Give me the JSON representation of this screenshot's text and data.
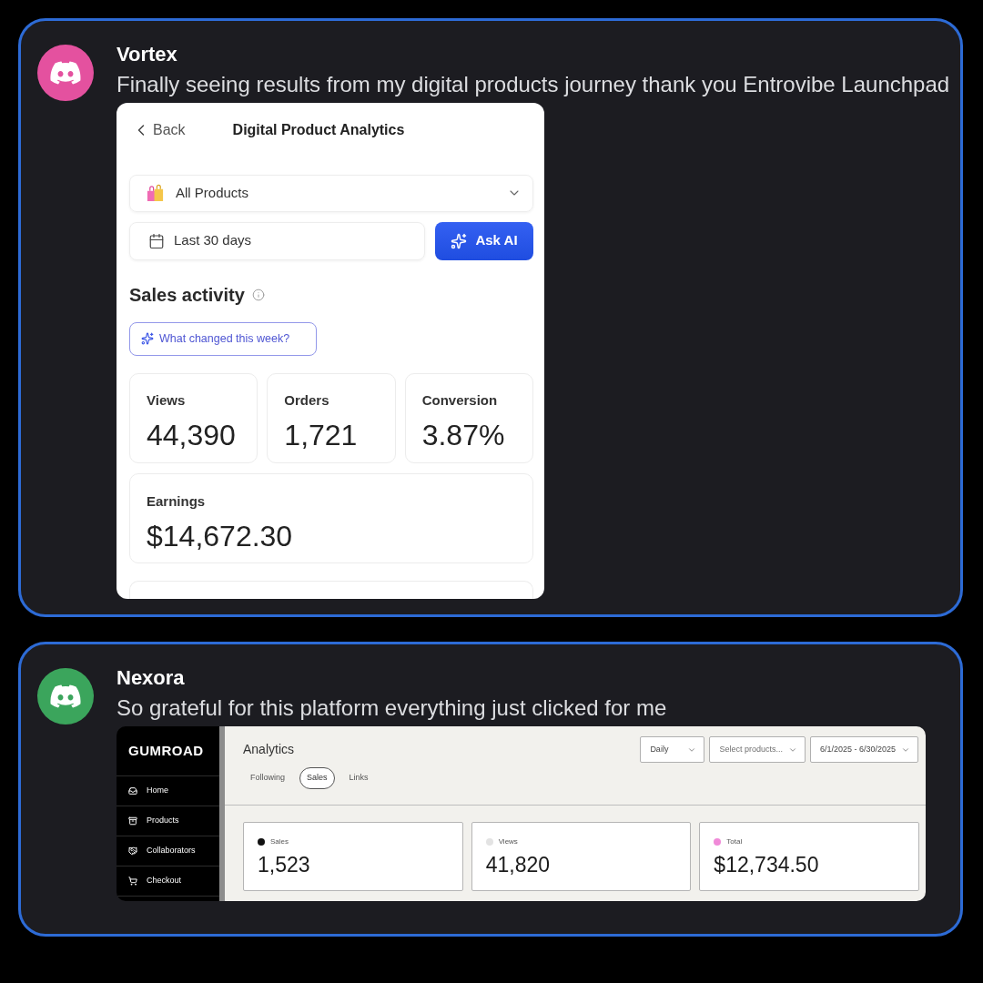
{
  "posts": [
    {
      "author": "Vortex",
      "message": "Finally seeing results from my digital products journey thank you Entrovibe Launchpad",
      "color": "#e4519f",
      "attachment": {
        "kind": "mobile",
        "back": "Back",
        "title": "Digital Product Analytics",
        "product_select": {
          "value": "All Products"
        },
        "date_select": {
          "value": "Last 30 days"
        },
        "ask_button": "Ask AI",
        "section_title": "Sales activity",
        "suggestion": "What changed this week?",
        "stats": [
          {
            "label": "Views",
            "value": "44,390"
          },
          {
            "label": "Orders",
            "value": "1,721"
          },
          {
            "label": "Conversion",
            "value": "3.87%"
          }
        ],
        "earnings": {
          "label": "Earnings",
          "value": "$14,672.30"
        }
      }
    },
    {
      "author": "Nexora",
      "message": "So grateful for this platform everything just clicked for me",
      "color": "#3ba55c",
      "attachment": {
        "kind": "dashboard",
        "logo": "GUMROAD",
        "nav": [
          {
            "label": "Home"
          },
          {
            "label": "Products"
          },
          {
            "label": "Collaborators"
          },
          {
            "label": "Checkout"
          }
        ],
        "title": "Analytics",
        "tabs": [
          {
            "label": "Following",
            "selected": false
          },
          {
            "label": "Sales",
            "selected": true
          },
          {
            "label": "Links",
            "selected": false
          }
        ],
        "filters": [
          {
            "value": "Daily"
          },
          {
            "placeholder": "Select products..."
          },
          {
            "value": "6/1/2025 - 6/30/2025"
          }
        ],
        "stats": [
          {
            "label": "Sales",
            "value": "1,523",
            "color": "#111111"
          },
          {
            "label": "Views",
            "value": "41,820",
            "color": "#e3e3e3"
          },
          {
            "label": "Total",
            "value": "$12,734.50",
            "color": "#f08ad8"
          }
        ]
      }
    }
  ]
}
